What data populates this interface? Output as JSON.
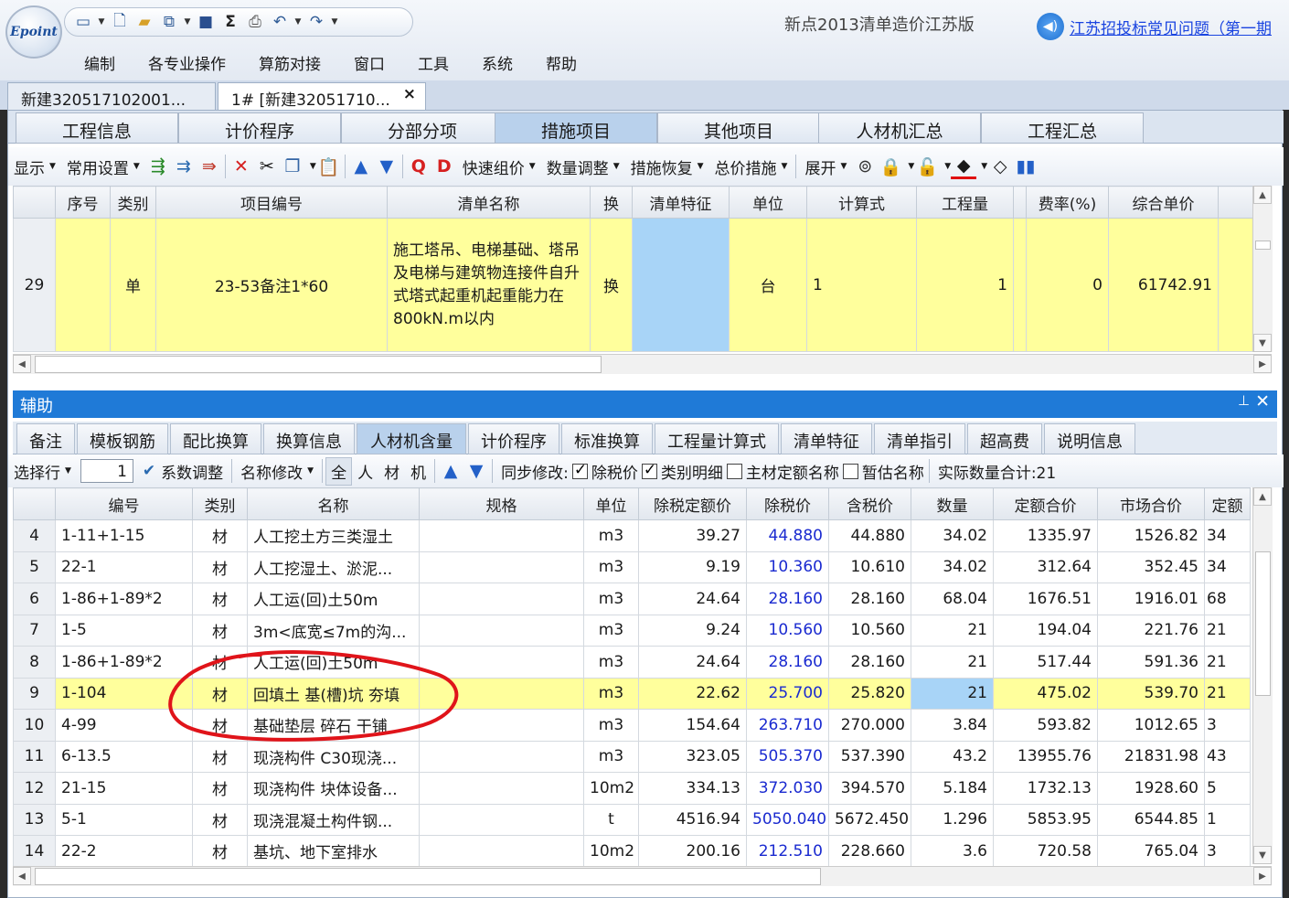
{
  "app": {
    "logo_text": "Epoint",
    "title": "新点2013清单造价江苏版",
    "ad_link": "江苏招投标常见问题（第一期",
    "menu": [
      "编制",
      "各专业操作",
      "算筋对接",
      "窗口",
      "工具",
      "系统",
      "帮助"
    ]
  },
  "doc_tabs": [
    {
      "label": "新建320517102001..."
    },
    {
      "label": "1# [新建32051710...",
      "close": "×"
    }
  ],
  "module_tabs": [
    "工程信息",
    "计价程序",
    "分部分项",
    "措施项目",
    "其他项目",
    "人材机汇总",
    "工程汇总"
  ],
  "module_active": 3,
  "toolbar1": {
    "show": "显示",
    "common": "常用设置",
    "quick_price": "快速组价",
    "qty_adjust": "数量调整",
    "measure_restore": "措施恢复",
    "total_measure": "总价措施",
    "expand": "展开"
  },
  "upper_grid": {
    "headers": [
      "",
      "序号",
      "类别",
      "项目编号",
      "清单名称",
      "换",
      "清单特征",
      "单位",
      "计算式",
      "工程量",
      "费率(%)",
      "综合单价",
      ""
    ],
    "row": {
      "rownum": "29",
      "seq": "",
      "type": "单",
      "code": "23-53备注1*60",
      "name": "施工塔吊、电梯基础、塔吊及电梯与建筑物连接件自升式塔式起重机起重能力在800kN.m以内",
      "swap": "换",
      "feature": "",
      "unit": "台",
      "formula": "1",
      "qty": "1",
      "rate": "0",
      "price": "61742.91"
    }
  },
  "aux": {
    "title": "辅助",
    "pin": "⊥",
    "close": "✕",
    "tabs": [
      "备注",
      "模板钢筋",
      "配比换算",
      "换算信息",
      "人材机含量",
      "计价程序",
      "标准换算",
      "工程量计算式",
      "清单特征",
      "清单指引",
      "超高费",
      "说明信息"
    ],
    "active_tab": 4
  },
  "toolbar2": {
    "select_row": "选择行",
    "row_value": "1",
    "coef_adjust": "系数调整",
    "name_modify": "名称修改",
    "filters": [
      "全",
      "人",
      "材",
      "机"
    ],
    "sync_label": "同步修改:",
    "tax_price": "除税价",
    "type_detail": "类别明细",
    "main_material": "主材定额名称",
    "temp_name": "暂估名称",
    "actual_total": "实际数量合计:21"
  },
  "lower_grid": {
    "headers": [
      "",
      "编号",
      "类别",
      "名称",
      "规格",
      "单位",
      "除税定额价",
      "除税价",
      "含税价",
      "数量",
      "定额合价",
      "市场合价",
      "定额"
    ],
    "rows": [
      {
        "n": "4",
        "code": "1-11+1-15",
        "type": "材",
        "name": "人工挖土方三类湿土",
        "spec": "",
        "unit": "m3",
        "quota": "39.27",
        "tax_ex": "44.880",
        "tax_in": "44.880",
        "qty": "34.02",
        "quota_total": "1335.97",
        "market_total": "1526.82",
        "extra": "34"
      },
      {
        "n": "5",
        "code": "22-1",
        "type": "材",
        "name": "人工挖湿土、淤泥...",
        "spec": "",
        "unit": "m3",
        "quota": "9.19",
        "tax_ex": "10.360",
        "tax_in": "10.610",
        "qty": "34.02",
        "quota_total": "312.64",
        "market_total": "352.45",
        "extra": "34"
      },
      {
        "n": "6",
        "code": "1-86+1-89*2",
        "type": "材",
        "name": "人工运(回)土50m",
        "spec": "",
        "unit": "m3",
        "quota": "24.64",
        "tax_ex": "28.160",
        "tax_in": "28.160",
        "qty": "68.04",
        "quota_total": "1676.51",
        "market_total": "1916.01",
        "extra": "68"
      },
      {
        "n": "7",
        "code": "1-5",
        "type": "材",
        "name": "3m<底宽≤7m的沟...",
        "spec": "",
        "unit": "m3",
        "quota": "9.24",
        "tax_ex": "10.560",
        "tax_in": "10.560",
        "qty": "21",
        "quota_total": "194.04",
        "market_total": "221.76",
        "extra": "21"
      },
      {
        "n": "8",
        "code": "1-86+1-89*2",
        "type": "材",
        "name": "人工运(回)土50m",
        "spec": "",
        "unit": "m3",
        "quota": "24.64",
        "tax_ex": "28.160",
        "tax_in": "28.160",
        "qty": "21",
        "quota_total": "517.44",
        "market_total": "591.36",
        "extra": "21"
      },
      {
        "n": "9",
        "code": "1-104",
        "type": "材",
        "name": "回填土 基(槽)坑 夯填",
        "spec": "",
        "unit": "m3",
        "quota": "22.62",
        "tax_ex": "25.700",
        "tax_in": "25.820",
        "qty": "21",
        "quota_total": "475.02",
        "market_total": "539.70",
        "extra": "21",
        "selected": true
      },
      {
        "n": "10",
        "code": "4-99",
        "type": "材",
        "name": "基础垫层  碎石 干铺",
        "spec": "",
        "unit": "m3",
        "quota": "154.64",
        "tax_ex": "263.710",
        "tax_in": "270.000",
        "qty": "3.84",
        "quota_total": "593.82",
        "market_total": "1012.65",
        "extra": "3"
      },
      {
        "n": "11",
        "code": "6-13.5",
        "type": "材",
        "name": "现浇构件  C30现浇...",
        "spec": "",
        "unit": "m3",
        "quota": "323.05",
        "tax_ex": "505.370",
        "tax_in": "537.390",
        "qty": "43.2",
        "quota_total": "13955.76",
        "market_total": "21831.98",
        "extra": "43"
      },
      {
        "n": "12",
        "code": "21-15",
        "type": "材",
        "name": "现浇构件  块体设备...",
        "spec": "",
        "unit": "10m2",
        "quota": "334.13",
        "tax_ex": "372.030",
        "tax_in": "394.570",
        "qty": "5.184",
        "quota_total": "1732.13",
        "market_total": "1928.60",
        "extra": "5"
      },
      {
        "n": "13",
        "code": "5-1",
        "type": "材",
        "name": "现浇混凝土构件钢...",
        "spec": "",
        "unit": "t",
        "quota": "4516.94",
        "tax_ex": "5050.040",
        "tax_in": "5672.450",
        "qty": "1.296",
        "quota_total": "5853.95",
        "market_total": "6544.85",
        "extra": "1"
      },
      {
        "n": "14",
        "code": "22-2",
        "type": "材",
        "name": "基坑、地下室排水",
        "spec": "",
        "unit": "10m2",
        "quota": "200.16",
        "tax_ex": "212.510",
        "tax_in": "228.660",
        "qty": "3.6",
        "quota_total": "720.58",
        "market_total": "765.04",
        "extra": "3"
      }
    ]
  },
  "colors": {
    "row_yellow": "#ffff9c",
    "selected_cell": "#a8d4f7",
    "aux_header": "#1f7ad7",
    "annotation_red": "#e0141a",
    "blue_price": "#1a2ad0"
  }
}
